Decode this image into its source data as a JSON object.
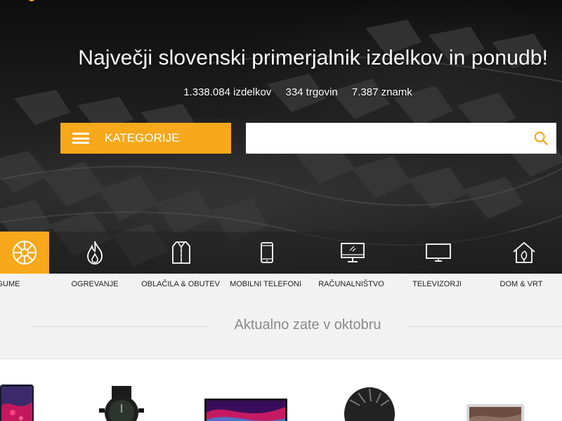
{
  "hero": {
    "headline": "Največji slovenski primerjalnik izdelkov in ponudb!",
    "stats": [
      "1.338.084 izdelkov",
      "334 trgovin",
      "7.387 znamk"
    ]
  },
  "categories_button": {
    "label": "KATEGORIJE",
    "icon": "hamburger-icon"
  },
  "search": {
    "placeholder": "",
    "value": "",
    "icon": "search-icon"
  },
  "accent_color": "#f7a81b",
  "category_strip": [
    {
      "label": "GUME",
      "icon": "tire-icon",
      "active": true
    },
    {
      "label": "OGREVANJE",
      "icon": "flame-icon",
      "active": false
    },
    {
      "label": "OBLAČILA & OBUTEV",
      "icon": "shirt-icon",
      "active": false
    },
    {
      "label": "MOBILNI TELEFONI",
      "icon": "smartphone-icon",
      "active": false
    },
    {
      "label": "RAČUNALNIŠTVO",
      "icon": "desktop-computer-icon",
      "active": false
    },
    {
      "label": "TELEVIZORJI",
      "icon": "tv-icon",
      "active": false
    },
    {
      "label": "DOM & VRT",
      "icon": "house-leaf-icon",
      "active": false
    }
  ],
  "section": {
    "title": "Aktualno zate v oktobru"
  },
  "products": [
    {
      "icon": "smartphone-product-image"
    },
    {
      "icon": "wristwatch-product-image"
    },
    {
      "icon": "television-product-image"
    },
    {
      "icon": "tire-product-image"
    },
    {
      "icon": "laptop-product-image"
    }
  ]
}
